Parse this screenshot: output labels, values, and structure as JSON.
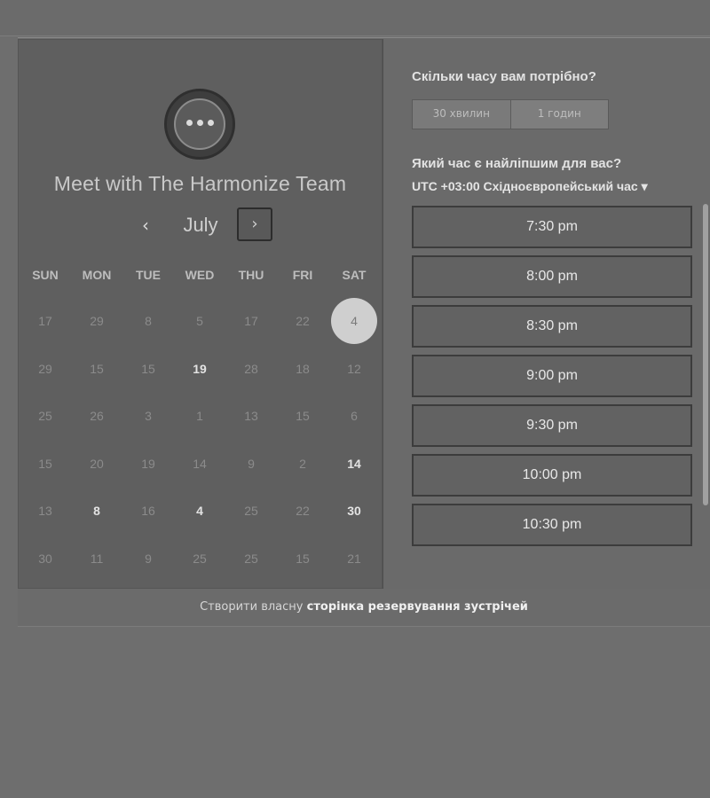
{
  "booking": {
    "title": "Meet with The Harmonize Team",
    "month": "July",
    "prev_icon": "‹",
    "next_icon": "›",
    "weekdays": [
      "SUN",
      "MON",
      "TUE",
      "WED",
      "THU",
      "FRI",
      "SAT"
    ],
    "weeks": [
      [
        "17",
        "29",
        "8",
        "5",
        "17",
        "22",
        "4"
      ],
      [
        "29",
        "15",
        "15",
        "19",
        "28",
        "18",
        "12"
      ],
      [
        "25",
        "26",
        "3",
        "1",
        "13",
        "15",
        "6"
      ],
      [
        "15",
        "20",
        "19",
        "14",
        "9",
        "2",
        "14"
      ],
      [
        "13",
        "8",
        "16",
        "4",
        "25",
        "22",
        "30"
      ],
      [
        "30",
        "11",
        "9",
        "25",
        "25",
        "15",
        "21"
      ]
    ]
  },
  "duration": {
    "question": "Скільки часу вам потрібно?",
    "options": [
      "30 хвилин",
      "1 годин"
    ]
  },
  "time": {
    "question": "Який час є найліпшим для вас?",
    "timezone": "UTC +03:00 Східноєвропейський час ▾",
    "slots": [
      "7:30 pm",
      "8:00 pm",
      "8:30 pm",
      "9:00 pm",
      "9:30 pm",
      "10:00 pm",
      "10:30 pm"
    ]
  },
  "footer": {
    "prefix": "Створити власну",
    "link": "сторінка резервування зустрічей"
  },
  "colors": {
    "selected_day": "#cfcfcf",
    "panel_dark": "#5f5f5f"
  }
}
